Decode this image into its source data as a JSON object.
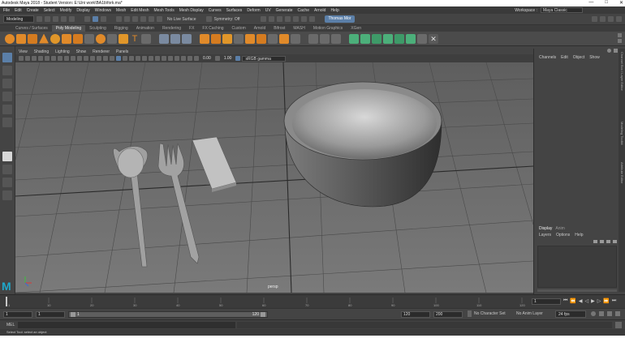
{
  "window": {
    "title": "Autodesk Maya 2018 - Student Version: E:\\Uni work\\BA1b\\fork.ma*",
    "controls": [
      "—",
      "□",
      "✕"
    ]
  },
  "menubar": {
    "items": [
      "File",
      "Edit",
      "Create",
      "Select",
      "Modify",
      "Display",
      "Windows",
      "Mesh",
      "Edit Mesh",
      "Mesh Tools",
      "Mesh Display",
      "Curves",
      "Surfaces",
      "Deform",
      "UV",
      "Generate",
      "Cache",
      "Arnold",
      "Help"
    ],
    "workspace_label": "Workspace :",
    "workspace_value": "Maya Classic"
  },
  "statusline": {
    "mode": "Modeling",
    "live_surface": "No Live Surface",
    "symmetry": "Symmetry: Off",
    "user": "Thomas Mor"
  },
  "shelf_tabs": {
    "items": [
      "Curves / Surfaces",
      "Poly Modeling",
      "Sculpting",
      "Rigging",
      "Animation",
      "Rendering",
      "FX",
      "FX Caching",
      "Custom",
      "Arnold",
      "Bifrost",
      "MASH",
      "Motion Graphics",
      "XGen"
    ],
    "active_index": 1
  },
  "panel": {
    "menu": [
      "View",
      "Shading",
      "Lighting",
      "Show",
      "Renderer",
      "Panels"
    ],
    "value_a": "0.00",
    "value_b": "1.00",
    "color_space": "sRGB gamma",
    "camera_label": "persp"
  },
  "channel_box": {
    "menu": [
      "Channels",
      "Edit",
      "Object",
      "Show"
    ]
  },
  "layer_editor": {
    "tabs": [
      "Display",
      "Anim"
    ],
    "menu": [
      "Layers",
      "Options",
      "Help"
    ]
  },
  "sidebar_tabs": [
    "Channel Box / Layer Editor",
    "Modeling Toolkit",
    "Attribute Editor"
  ],
  "timeslider": {
    "ticks": [
      "1",
      "10",
      "20",
      "30",
      "40",
      "50",
      "60",
      "70",
      "80",
      "90",
      "100",
      "110",
      "120"
    ],
    "current_frame": "1"
  },
  "rangeslider": {
    "start": "1",
    "start_inner": "1",
    "range_start_label": "1",
    "range_end_label": "120",
    "end_inner": "120",
    "end": "200",
    "character_set": "No Character Set",
    "anim_layer": "No Anim Layer",
    "fps": "24 fps"
  },
  "cmdline": {
    "label": "MEL"
  },
  "helpline": {
    "text": "Select Tool: select an object"
  },
  "colors": {
    "accent": "#5b7fa8",
    "shelf_icon_orange": "#e08a2a",
    "shelf_icon_green": "#4caf7a",
    "maya_logo": "#1fa7c9"
  }
}
